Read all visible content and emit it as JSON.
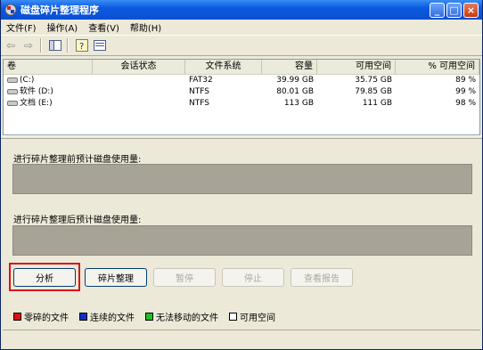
{
  "window": {
    "title": "磁盘碎片整理程序"
  },
  "menu": [
    "文件(F)",
    "操作(A)",
    "查看(V)",
    "帮助(H)"
  ],
  "columns": [
    "卷",
    "会话状态",
    "文件系统",
    "容量",
    "可用空间",
    "% 可用空间"
  ],
  "volumes": [
    {
      "name": "(C:)",
      "status": "",
      "fs": "FAT32",
      "capacity": "39.99 GB",
      "free": "35.75 GB",
      "pct": "89 %"
    },
    {
      "name": "软件 (D:)",
      "status": "",
      "fs": "NTFS",
      "capacity": "80.01 GB",
      "free": "79.85 GB",
      "pct": "99 %"
    },
    {
      "name": "文档 (E:)",
      "status": "",
      "fs": "NTFS",
      "capacity": "113 GB",
      "free": "111 GB",
      "pct": "98 %"
    }
  ],
  "before_label": "进行碎片整理前预计磁盘使用量:",
  "after_label": "进行碎片整理后预计磁盘使用量:",
  "buttons": {
    "analyze": "分析",
    "defrag": "碎片整理",
    "pause": "暂停",
    "stop": "停止",
    "report": "查看报告"
  },
  "legend": [
    {
      "label": "零碎的文件",
      "color": "#e01010"
    },
    {
      "label": "连续的文件",
      "color": "#1030c0"
    },
    {
      "label": "无法移动的文件",
      "color": "#20c020"
    },
    {
      "label": "可用空间",
      "color": "#ffffff"
    }
  ]
}
